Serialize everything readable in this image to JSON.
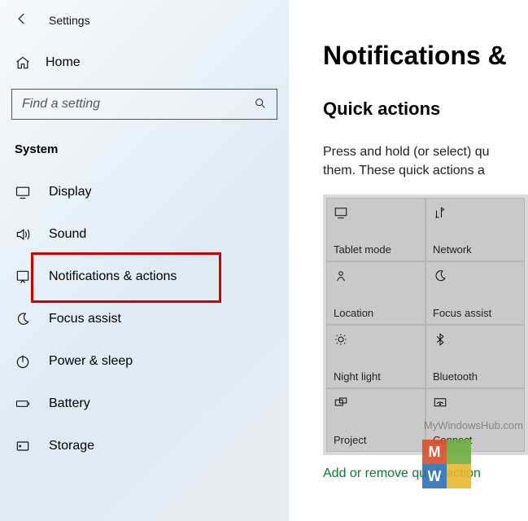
{
  "titlebar": {
    "app_name": "Settings"
  },
  "home": {
    "label": "Home"
  },
  "search": {
    "placeholder": "Find a setting"
  },
  "category": {
    "label": "System"
  },
  "nav": {
    "display": "Display",
    "sound": "Sound",
    "notifications": "Notifications & actions",
    "focus": "Focus assist",
    "power": "Power & sleep",
    "battery": "Battery",
    "storage": "Storage"
  },
  "main": {
    "heading": "Notifications &",
    "subheading": "Quick actions",
    "desc_line1": "Press and hold (or select) qu",
    "desc_line2": "them. These quick actions a",
    "add_link": "Add or remove quick action"
  },
  "tiles": {
    "tablet": "Tablet mode",
    "network": "Network",
    "location": "Location",
    "focus": "Focus assist",
    "nightlight": "Night light",
    "bluetooth": "Bluetooth",
    "project": "Project",
    "connect": "Connect"
  },
  "watermark": "MyWindowsHub.com"
}
